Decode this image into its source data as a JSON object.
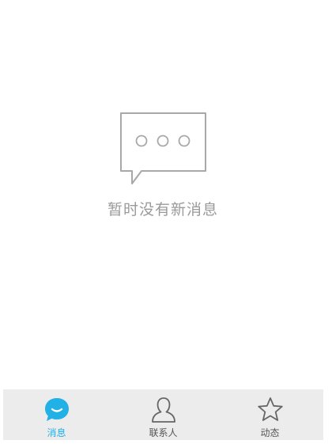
{
  "empty_state": {
    "message": "暂时没有新消息",
    "icon": "chat-bubble-ellipsis-icon"
  },
  "tab_bar": {
    "active_color": "#21b1e6",
    "inactive_color": "#555555",
    "tabs": [
      {
        "label": "消息",
        "icon": "message-bubble-icon",
        "active": true
      },
      {
        "label": "联系人",
        "icon": "person-icon",
        "active": false
      },
      {
        "label": "动态",
        "icon": "star-icon",
        "active": false
      }
    ]
  }
}
